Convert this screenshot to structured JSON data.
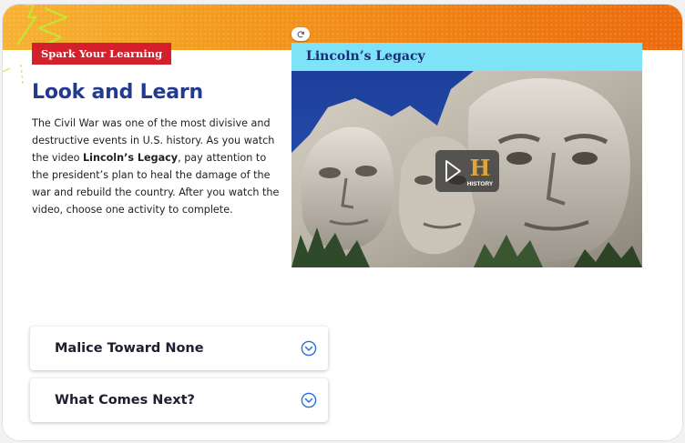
{
  "tag": {
    "label": "Spark Your Learning"
  },
  "main": {
    "title": "Look and Learn",
    "paragraph_1": "The Civil War was one of the most divisive and destructive events in U.S. history. As you watch the video ",
    "paragraph_bold": "Lincoln’s Legacy",
    "paragraph_2": ", pay attention to the president’s plan to heal the damage of the war and rebuild the country. After you watch the video, choose one activity to complete."
  },
  "video": {
    "title": "Lincoln’s Legacy",
    "brand_letter": "H",
    "brand_text": "HISTORY"
  },
  "accordions": [
    {
      "label": "Malice Toward None"
    },
    {
      "label": "What Comes Next?"
    }
  ],
  "colors": {
    "banner": "#ef7d12",
    "tag": "#d3202c",
    "title": "#243a8f",
    "video_header": "#7ee3f7",
    "accent_icon": "#2a6fd6"
  },
  "icons": [
    "lightning-bolt-icon",
    "refresh-icon",
    "play-icon",
    "history-logo",
    "chevron-down-circle-icon"
  ]
}
